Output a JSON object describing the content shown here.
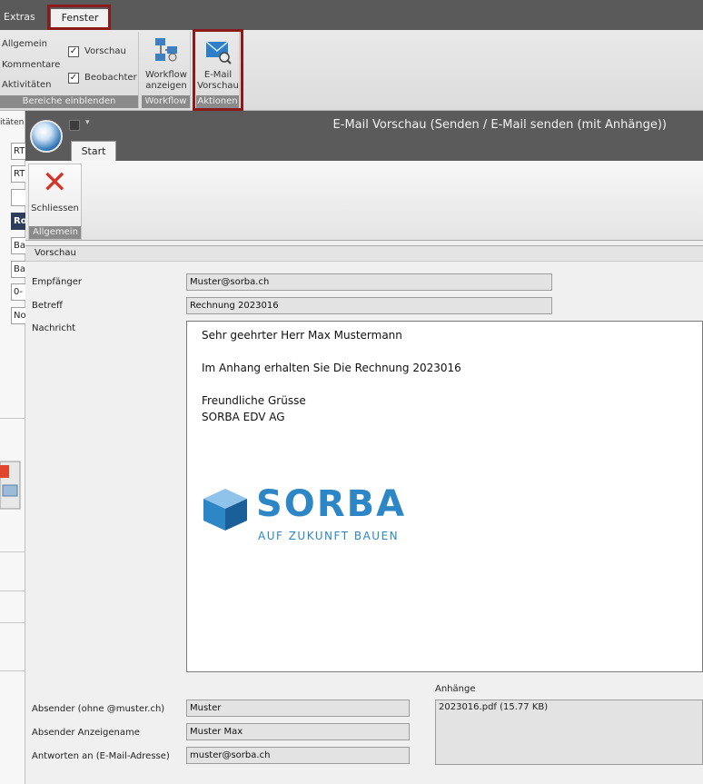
{
  "background_app": {
    "menu_tabs": [
      "Extras",
      "Fenster"
    ],
    "ribbon": {
      "bereiche": {
        "items": [
          "Allgemein",
          "Kommentare",
          "Aktivitäten"
        ],
        "checkboxes": [
          {
            "label": "Vorschau",
            "checked": true
          },
          {
            "label": "Beobachter",
            "checked": true
          }
        ],
        "group_label": "Bereiche einblenden"
      },
      "workflow": {
        "button_line1": "Workflow",
        "button_line2": "anzeigen",
        "group_label": "Workflow"
      },
      "aktionen": {
        "button_line1": "E-Mail",
        "button_line2": "Vorschau",
        "group_label": "Aktionen"
      }
    },
    "left_panel_fragments": [
      "itäten",
      "RT",
      "RT",
      "",
      "Ro",
      "Ba",
      "Ba",
      "0-",
      "No"
    ]
  },
  "dialog": {
    "title": "E-Mail Vorschau (Senden / E-Mail senden (mit Anhänge))",
    "tab": "Start",
    "close_button": "Schliessen",
    "group_label": "Allgemein",
    "section_title": "Vorschau",
    "fields": {
      "empfaenger_label": "Empfänger",
      "empfaenger_value": "Muster@sorba.ch",
      "betreff_label": "Betreff",
      "betreff_value": "Rechnung 2023016",
      "nachricht_label": "Nachricht"
    },
    "message": {
      "greeting": "Sehr geehrter Herr Max Mustermann",
      "body": "Im Anhang erhalten Sie Die Rechnung 2023016",
      "closing": "Freundliche Grüsse",
      "company": "SORBA EDV AG",
      "logo_word": "SORBA",
      "logo_tagline": "AUF ZUKUNFT BAUEN",
      "logo_color": "#2d86c6"
    },
    "sender": {
      "absender_label": "Absender (ohne @muster.ch)",
      "absender_value": "Muster",
      "anzeigename_label": "Absender Anzeigename",
      "anzeigename_value": "Muster Max",
      "antworten_label": "Antworten an (E-Mail-Adresse)",
      "antworten_value": "muster@sorba.ch"
    },
    "attachments": {
      "label": "Anhänge",
      "items": [
        "2023016.pdf (15.77 KB)"
      ]
    }
  },
  "colors": {
    "highlight_frame": "#8b1a1a",
    "close_icon": "#d6322a",
    "title_bar": "#5b5b5b"
  }
}
